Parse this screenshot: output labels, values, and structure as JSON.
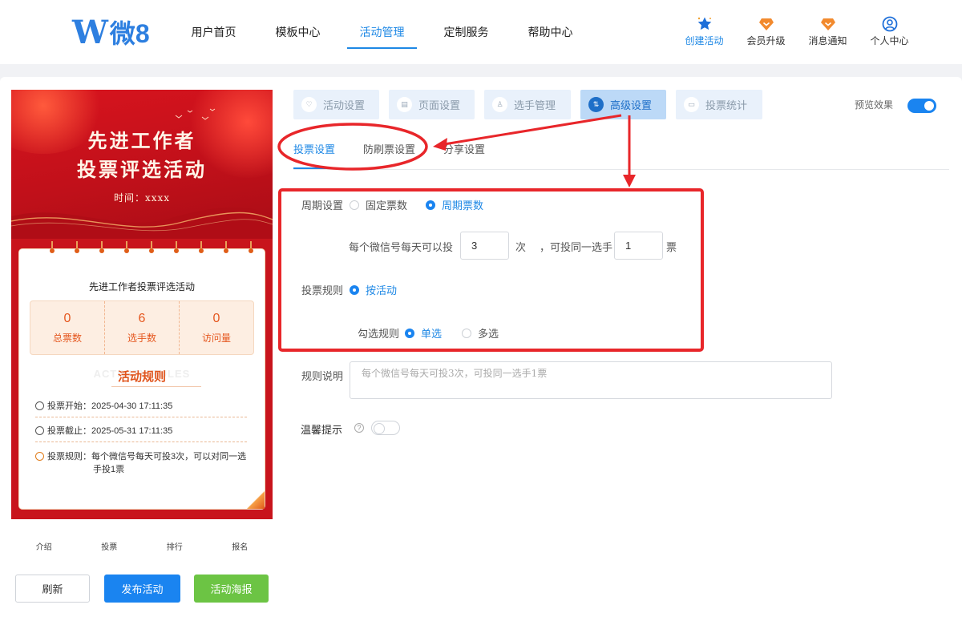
{
  "brand": {
    "logo_mark": "W",
    "logo_text": "微8"
  },
  "nav": {
    "items": [
      {
        "label": "用户首页"
      },
      {
        "label": "模板中心"
      },
      {
        "label": "活动管理",
        "active": true
      },
      {
        "label": "定制服务"
      },
      {
        "label": "帮助中心"
      }
    ]
  },
  "tools": [
    {
      "label": "创建活动",
      "icon": "star-icon"
    },
    {
      "label": "会员升级",
      "icon": "diamond-icon"
    },
    {
      "label": "消息通知",
      "icon": "diamond-icon"
    },
    {
      "label": "个人中心",
      "icon": "user-circle-icon"
    }
  ],
  "phone": {
    "banner_title_1": "先进工作者",
    "banner_title_2": "投票评选活动",
    "banner_time": "时间：xxxx",
    "activity_title": "先进工作者投票评选活动",
    "stats": [
      {
        "value": "0",
        "label": "总票数"
      },
      {
        "value": "6",
        "label": "选手数"
      },
      {
        "value": "0",
        "label": "访问量"
      }
    ],
    "rules_bg": "ACTIVITY RULES",
    "rules_title": "活动规则",
    "rules": [
      {
        "label": "投票开始：",
        "value": "2025-04-30 17:11:35"
      },
      {
        "label": "投票截止：",
        "value": "2025-05-31 17:11:35"
      },
      {
        "label": "投票规则：",
        "value": "每个微信号每天可投3次，可以对同一选手投1票"
      }
    ],
    "tabs": [
      "介绍",
      "投票",
      "排行",
      "报名"
    ]
  },
  "buttons": {
    "refresh": "刷新",
    "publish": "发布活动",
    "poster": "活动海报"
  },
  "step_tabs": [
    {
      "label": "活动设置",
      "icon": "heart-icon"
    },
    {
      "label": "页面设置",
      "icon": "page-icon"
    },
    {
      "label": "选手管理",
      "icon": "user-icon"
    },
    {
      "label": "高级设置",
      "icon": "sliders-icon",
      "active": true
    },
    {
      "label": "投票统计",
      "icon": "chart-icon"
    }
  ],
  "preview": {
    "label": "预览效果",
    "on": true
  },
  "sub_tabs": [
    {
      "label": "投票设置",
      "active": true
    },
    {
      "label": "防刷票设置"
    },
    {
      "label": "分享设置"
    }
  ],
  "form": {
    "cycle_label": "周期设置",
    "cycle_options": [
      {
        "label": "固定票数",
        "checked": false
      },
      {
        "label": "周期票数",
        "checked": true
      }
    ],
    "per_day_prefix": "每个微信号每天可以投",
    "per_day_value": "3",
    "per_day_unit": "次",
    "same_player_prefix": "，可投同一选手",
    "same_player_value": "1",
    "same_player_unit": "票",
    "vote_rule_label": "投票规则",
    "vote_rule_option": "按活动",
    "select_rule_label": "勾选规则",
    "select_options": [
      {
        "label": "单选",
        "checked": true
      },
      {
        "label": "多选",
        "checked": false
      }
    ],
    "rule_desc_label": "规则说明",
    "rule_desc_placeholder": "每个微信号每天可投3次，可投同一选手1票",
    "tip_label": "温馨提示",
    "tip_on": false
  },
  "colors": {
    "primary": "#1a84f0",
    "annotation": "#e8262a",
    "banner": "#c8141c",
    "success": "#6cc444"
  }
}
